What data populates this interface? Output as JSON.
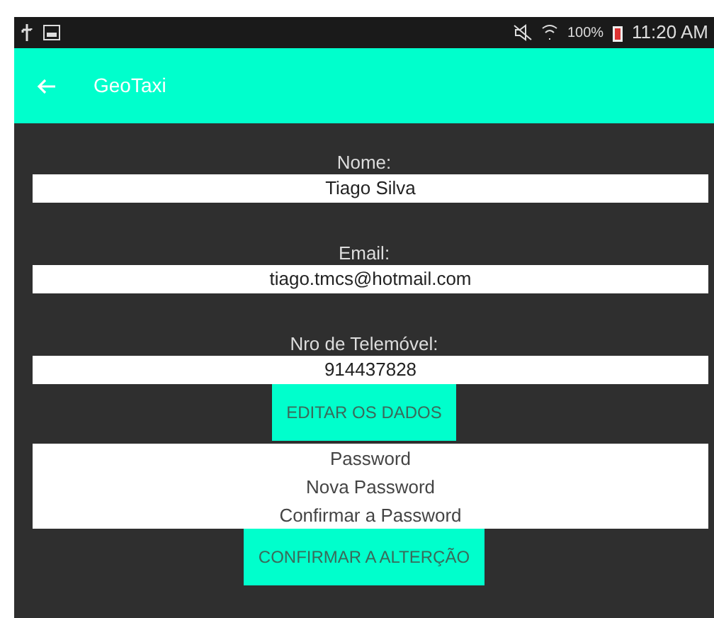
{
  "status_bar": {
    "battery": "100%",
    "time": "11:20 AM"
  },
  "app_bar": {
    "title": "GeoTaxi"
  },
  "fields": [
    {
      "label": "Nome:",
      "value": "Tiago Silva"
    },
    {
      "label": "Email:",
      "value": "tiago.tmcs@hotmail.com"
    },
    {
      "label": "Nro de Telemóvel:",
      "value": "914437828"
    }
  ],
  "edit_button": "EDITAR OS DADOS",
  "password_fields": [
    {
      "placeholder": "Password"
    },
    {
      "placeholder": "Nova Password"
    },
    {
      "placeholder": "Confirmar a Password"
    }
  ],
  "confirm_button": "CONFIRMAR A ALTERÇÃO"
}
